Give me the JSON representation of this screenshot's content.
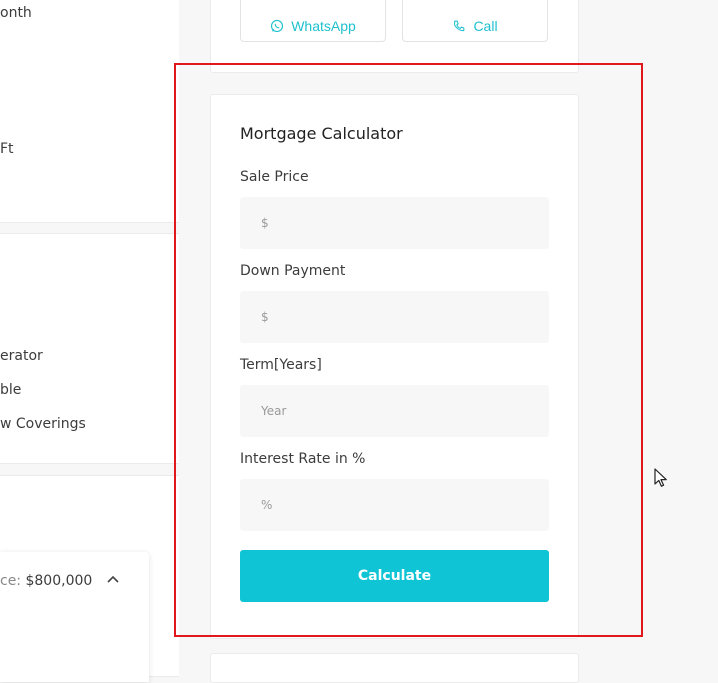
{
  "left_column": {
    "fragment_month": "onth",
    "fragment_sqft": "Ft",
    "fragment_refrigerator": "erator",
    "fragment_table": "ble",
    "fragment_window_coverings": "w Coverings",
    "price_label": "ce:",
    "price_value": "$800,000"
  },
  "contact": {
    "whatsapp_label": "WhatsApp",
    "call_label": "Call"
  },
  "mortgage": {
    "title": "Mortgage Calculator",
    "fields": [
      {
        "label": "Sale Price",
        "placeholder": "$"
      },
      {
        "label": "Down Payment",
        "placeholder": "$"
      },
      {
        "label": "Term[Years]",
        "placeholder": "Year"
      },
      {
        "label": "Interest Rate in %",
        "placeholder": "%"
      }
    ],
    "calculate_label": "Calculate"
  },
  "colors": {
    "accent": "#0fc4d4",
    "highlight": "#e0171b"
  }
}
